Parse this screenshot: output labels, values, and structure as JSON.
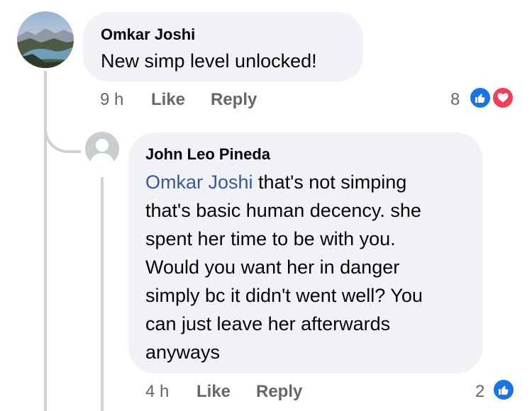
{
  "comment": {
    "author": "Omkar Joshi",
    "text": "New simp level unlocked!",
    "time": "9 h",
    "like_label": "Like",
    "reply_label": "Reply",
    "reaction_count": "8",
    "reactions": [
      "like-icon",
      "love-icon"
    ]
  },
  "reply": {
    "author": "John Leo Pineda",
    "mention": "Omkar Joshi",
    "text_lines": [
      " that's not simping",
      "that's basic human decency. she",
      "spent her time to be with you.",
      "Would you want her in danger",
      "simply bc it didn't went well? You",
      "can just leave her afterwards",
      "anyways"
    ],
    "time": "4 h",
    "like_label": "Like",
    "reply_label": "Reply",
    "reaction_count": "2",
    "reactions": [
      "like-icon"
    ]
  },
  "colors": {
    "bubble": "#f0f2f5",
    "mention": "#385898",
    "meta": "#65676b",
    "like": "#1b74e4",
    "love": "#f33e58"
  }
}
